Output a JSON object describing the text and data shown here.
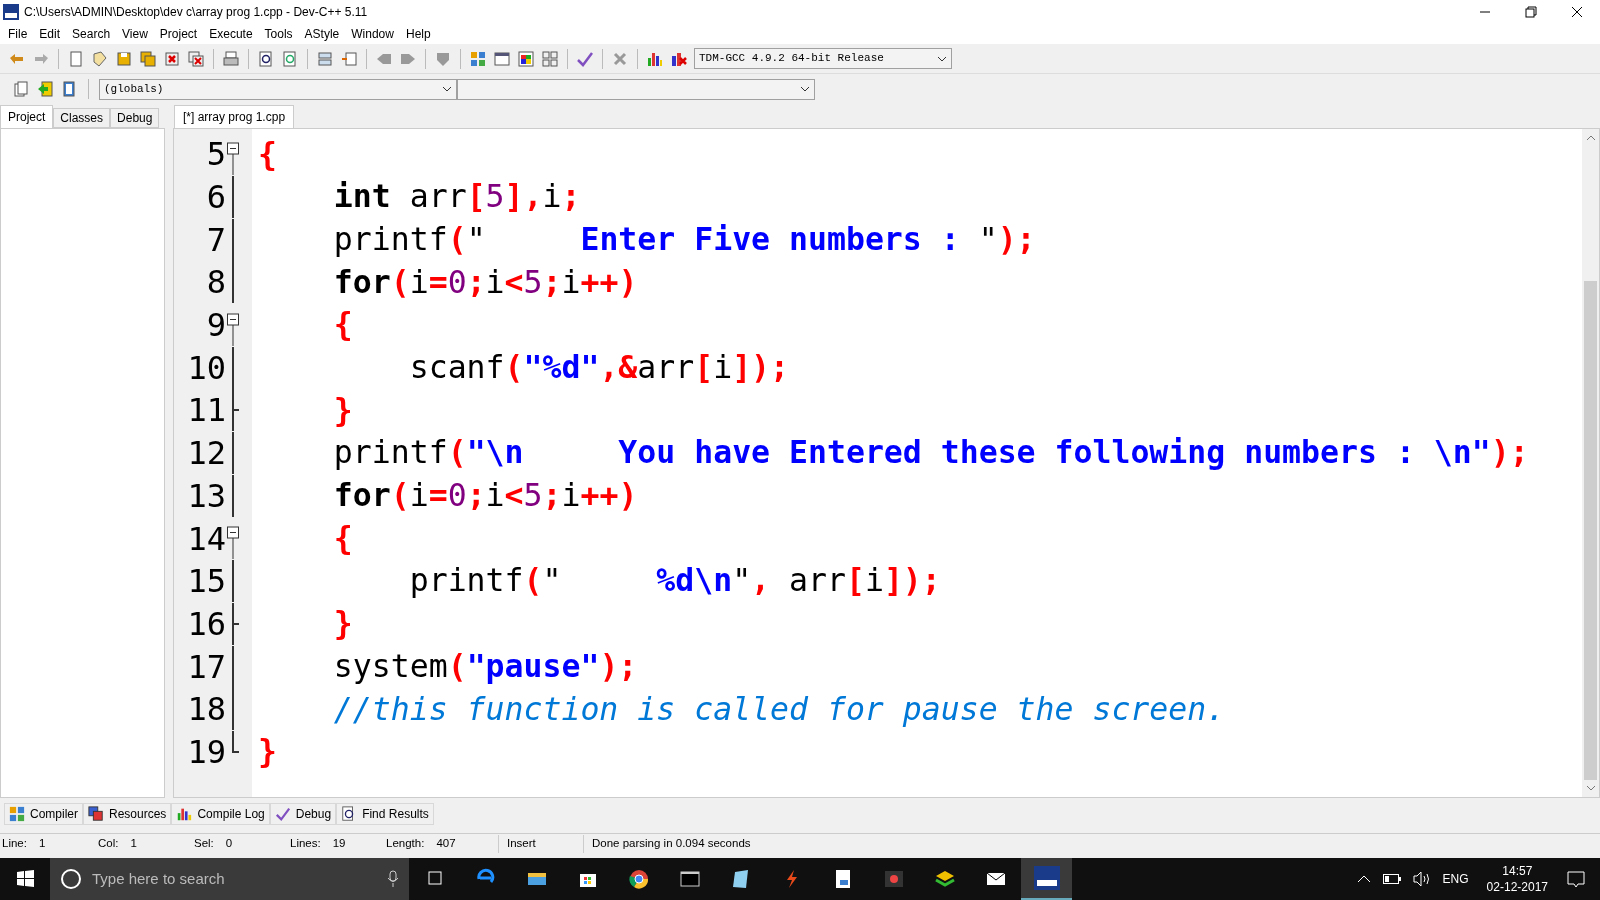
{
  "window": {
    "title": "C:\\Users\\ADMIN\\Desktop\\dev c\\array prog 1.cpp - Dev-C++ 5.11"
  },
  "menu": [
    "File",
    "Edit",
    "Search",
    "View",
    "Project",
    "Execute",
    "Tools",
    "AStyle",
    "Window",
    "Help"
  ],
  "toolbar": {
    "compiler_select": "TDM-GCC 4.9.2 64-bit Release",
    "scope_select": "(globals)"
  },
  "left_tabs": [
    {
      "label": "Project",
      "selected": true
    },
    {
      "label": "Classes",
      "selected": false
    },
    {
      "label": "Debug",
      "selected": false
    }
  ],
  "editor_tabs": [
    {
      "label": "[*] array prog 1.cpp",
      "selected": true
    }
  ],
  "code_lines": [
    {
      "number": "5",
      "kind": "fold-start",
      "tokens": [
        {
          "kind": "sym",
          "text": "{"
        }
      ]
    },
    {
      "number": "6",
      "kind": "body",
      "tokens": [
        {
          "kind": "kw",
          "text": "    int"
        },
        {
          "kind": "plain",
          "text": " arr"
        },
        {
          "kind": "sym",
          "text": "["
        },
        {
          "kind": "num",
          "text": "5"
        },
        {
          "kind": "sym",
          "text": "],"
        },
        {
          "kind": "plain",
          "text": "i"
        },
        {
          "kind": "sym",
          "text": ";"
        }
      ]
    },
    {
      "number": "7",
      "kind": "body",
      "tokens": [
        {
          "kind": "plain",
          "text": "    printf"
        },
        {
          "kind": "sym",
          "text": "("
        },
        {
          "kind": "plain",
          "text": "\"     "
        },
        {
          "kind": "str",
          "text": "Enter Five numbers : "
        },
        {
          "kind": "plain",
          "text": "\""
        },
        {
          "kind": "sym",
          "text": ");"
        }
      ]
    },
    {
      "number": "8",
      "kind": "body",
      "tokens": [
        {
          "kind": "kw",
          "text": "    for"
        },
        {
          "kind": "sym",
          "text": "("
        },
        {
          "kind": "plain",
          "text": "i"
        },
        {
          "kind": "sym",
          "text": "="
        },
        {
          "kind": "num",
          "text": "0"
        },
        {
          "kind": "sym",
          "text": ";"
        },
        {
          "kind": "plain",
          "text": "i"
        },
        {
          "kind": "sym",
          "text": "<"
        },
        {
          "kind": "num",
          "text": "5"
        },
        {
          "kind": "sym",
          "text": ";"
        },
        {
          "kind": "plain",
          "text": "i"
        },
        {
          "kind": "sym",
          "text": "++)"
        }
      ]
    },
    {
      "number": "9",
      "kind": "fold-start",
      "tokens": [
        {
          "kind": "sym",
          "text": "    {"
        }
      ]
    },
    {
      "number": "10",
      "kind": "body",
      "tokens": [
        {
          "kind": "plain",
          "text": "        scanf"
        },
        {
          "kind": "sym",
          "text": "("
        },
        {
          "kind": "str",
          "text": "\"%d\""
        },
        {
          "kind": "sym",
          "text": ",&"
        },
        {
          "kind": "plain",
          "text": "arr"
        },
        {
          "kind": "sym",
          "text": "["
        },
        {
          "kind": "plain",
          "text": "i"
        },
        {
          "kind": "sym",
          "text": "]);"
        }
      ]
    },
    {
      "number": "11",
      "kind": "fold-end",
      "tokens": [
        {
          "kind": "sym",
          "text": "    }"
        }
      ]
    },
    {
      "number": "12",
      "kind": "body",
      "tokens": [
        {
          "kind": "plain",
          "text": "    printf"
        },
        {
          "kind": "sym",
          "text": "("
        },
        {
          "kind": "str",
          "text": "\"\\n     You have Entered these following numbers : \\n\""
        },
        {
          "kind": "sym",
          "text": ");"
        }
      ]
    },
    {
      "number": "13",
      "kind": "body",
      "tokens": [
        {
          "kind": "kw",
          "text": "    for"
        },
        {
          "kind": "sym",
          "text": "("
        },
        {
          "kind": "plain",
          "text": "i"
        },
        {
          "kind": "sym",
          "text": "="
        },
        {
          "kind": "num",
          "text": "0"
        },
        {
          "kind": "sym",
          "text": ";"
        },
        {
          "kind": "plain",
          "text": "i"
        },
        {
          "kind": "sym",
          "text": "<"
        },
        {
          "kind": "num",
          "text": "5"
        },
        {
          "kind": "sym",
          "text": ";"
        },
        {
          "kind": "plain",
          "text": "i"
        },
        {
          "kind": "sym",
          "text": "++)"
        }
      ]
    },
    {
      "number": "14",
      "kind": "fold-start",
      "tokens": [
        {
          "kind": "sym",
          "text": "    {"
        }
      ]
    },
    {
      "number": "15",
      "kind": "body",
      "tokens": [
        {
          "kind": "plain",
          "text": "        printf"
        },
        {
          "kind": "sym",
          "text": "("
        },
        {
          "kind": "plain",
          "text": "\"     "
        },
        {
          "kind": "str",
          "text": "%d\\n"
        },
        {
          "kind": "plain",
          "text": "\""
        },
        {
          "kind": "sym",
          "text": ","
        },
        {
          "kind": "plain",
          "text": " arr"
        },
        {
          "kind": "sym",
          "text": "["
        },
        {
          "kind": "plain",
          "text": "i"
        },
        {
          "kind": "sym",
          "text": "]);"
        }
      ]
    },
    {
      "number": "16",
      "kind": "fold-end",
      "tokens": [
        {
          "kind": "sym",
          "text": "    }"
        }
      ]
    },
    {
      "number": "17",
      "kind": "body",
      "tokens": [
        {
          "kind": "plain",
          "text": "    system"
        },
        {
          "kind": "sym",
          "text": "("
        },
        {
          "kind": "str",
          "text": "\"pause\""
        },
        {
          "kind": "sym",
          "text": ");"
        }
      ]
    },
    {
      "number": "18",
      "kind": "body",
      "tokens": [
        {
          "kind": "comment",
          "text": "    //this function is called for pause the screen."
        }
      ]
    },
    {
      "number": "19",
      "kind": "last",
      "tokens": [
        {
          "kind": "sym",
          "text": "}"
        }
      ]
    }
  ],
  "bottom_tabs": [
    "Compiler",
    "Resources",
    "Compile Log",
    "Debug",
    "Find Results"
  ],
  "status_bar": [
    {
      "label": "Line:",
      "value": "1"
    },
    {
      "label": "Col:",
      "value": "1"
    },
    {
      "label": "Sel:",
      "value": "0"
    },
    {
      "label": "Lines:",
      "value": "19"
    },
    {
      "label": "Length:",
      "value": "407"
    }
  ],
  "status_mode": "Insert",
  "status_message": "Done parsing in 0.094 seconds",
  "taskbar": {
    "search_placeholder": "Type here to search",
    "language": "ENG",
    "time": "14:57",
    "date": "02-12-2017"
  }
}
